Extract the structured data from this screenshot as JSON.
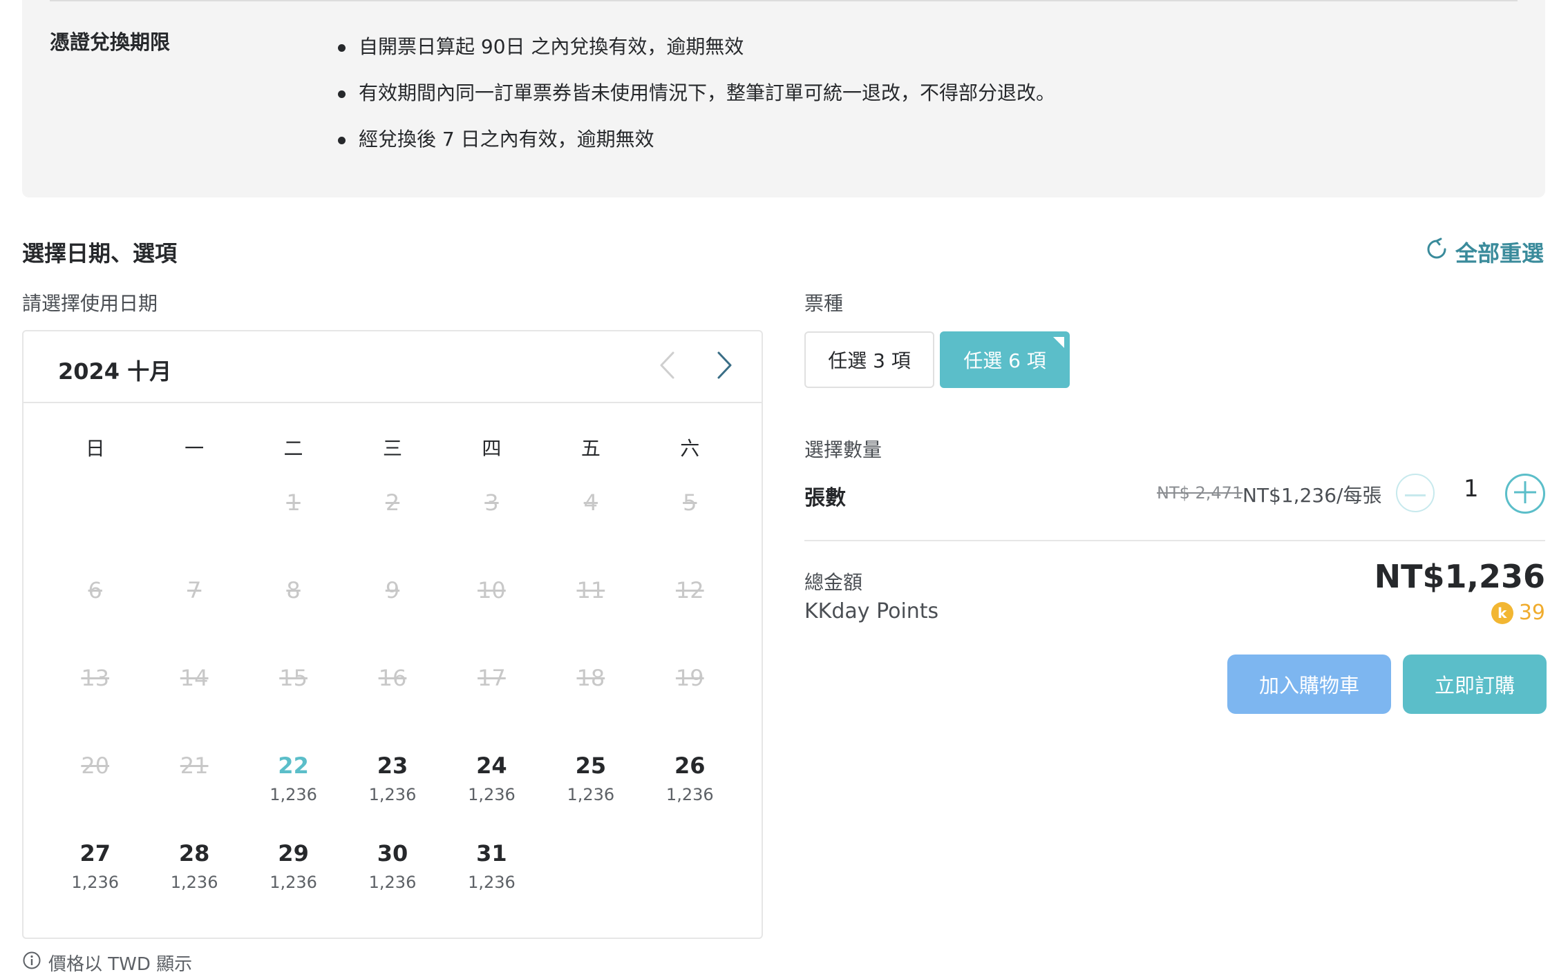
{
  "redemption": {
    "title": "憑證兌換期限",
    "rules": [
      "自開票日算起 90日 之內兌換有效，逾期無效",
      "有效期間內同一訂單票券皆未使用情況下，整筆訂單可統一退改，不得部分退改。",
      "經兌換後 7 日之內有效，逾期無效"
    ]
  },
  "section": {
    "title": "選擇日期、選項",
    "reset_label": "全部重選"
  },
  "calendar": {
    "label": "請選擇使用日期",
    "month_title": "2024 十月",
    "weekdays": [
      "日",
      "一",
      "二",
      "三",
      "四",
      "五",
      "六"
    ],
    "leading_blanks": 2,
    "days": [
      {
        "day": "1",
        "status": "disabled",
        "price": ""
      },
      {
        "day": "2",
        "status": "disabled",
        "price": ""
      },
      {
        "day": "3",
        "status": "disabled",
        "price": ""
      },
      {
        "day": "4",
        "status": "disabled",
        "price": ""
      },
      {
        "day": "5",
        "status": "disabled",
        "price": ""
      },
      {
        "day": "6",
        "status": "disabled",
        "price": ""
      },
      {
        "day": "7",
        "status": "disabled",
        "price": ""
      },
      {
        "day": "8",
        "status": "disabled",
        "price": ""
      },
      {
        "day": "9",
        "status": "disabled",
        "price": ""
      },
      {
        "day": "10",
        "status": "disabled",
        "price": ""
      },
      {
        "day": "11",
        "status": "disabled",
        "price": ""
      },
      {
        "day": "12",
        "status": "disabled",
        "price": ""
      },
      {
        "day": "13",
        "status": "disabled",
        "price": ""
      },
      {
        "day": "14",
        "status": "disabled",
        "price": ""
      },
      {
        "day": "15",
        "status": "disabled",
        "price": ""
      },
      {
        "day": "16",
        "status": "disabled",
        "price": ""
      },
      {
        "day": "17",
        "status": "disabled",
        "price": ""
      },
      {
        "day": "18",
        "status": "disabled",
        "price": ""
      },
      {
        "day": "19",
        "status": "disabled",
        "price": ""
      },
      {
        "day": "20",
        "status": "disabled",
        "price": ""
      },
      {
        "day": "21",
        "status": "disabled",
        "price": ""
      },
      {
        "day": "22",
        "status": "today",
        "price": "1,236"
      },
      {
        "day": "23",
        "status": "available",
        "price": "1,236"
      },
      {
        "day": "24",
        "status": "available",
        "price": "1,236"
      },
      {
        "day": "25",
        "status": "available",
        "price": "1,236"
      },
      {
        "day": "26",
        "status": "available",
        "price": "1,236"
      },
      {
        "day": "27",
        "status": "available",
        "price": "1,236"
      },
      {
        "day": "28",
        "status": "available",
        "price": "1,236"
      },
      {
        "day": "29",
        "status": "available",
        "price": "1,236"
      },
      {
        "day": "30",
        "status": "available",
        "price": "1,236"
      },
      {
        "day": "31",
        "status": "available",
        "price": "1,236"
      }
    ],
    "price_note": "價格以 TWD 顯示"
  },
  "ticket": {
    "label": "票種",
    "options": [
      "任選 3 項",
      "任選 6 項"
    ],
    "selected_index": 1
  },
  "quantity": {
    "label": "選擇數量",
    "row_label": "張數",
    "original_price": "NT$ 2,471",
    "unit_price": "NT$1,236/每張",
    "value": "1"
  },
  "summary": {
    "total_label": "總金額",
    "total_value": "NT$1,236",
    "points_label": "KKday Points",
    "points_coin": "k",
    "points_value": "39"
  },
  "actions": {
    "cart_label": "加入購物車",
    "book_label": "立即訂購"
  },
  "colors": {
    "accent": "#5bbec9",
    "reset_text": "#3a8b9b",
    "cart_button": "#7db6f0",
    "points": "#f0ac2e"
  },
  "icons": [
    "refresh-icon",
    "chevron-left-icon",
    "chevron-right-icon",
    "minus-icon",
    "plus-icon",
    "info-icon",
    "kkday-coin-icon"
  ]
}
